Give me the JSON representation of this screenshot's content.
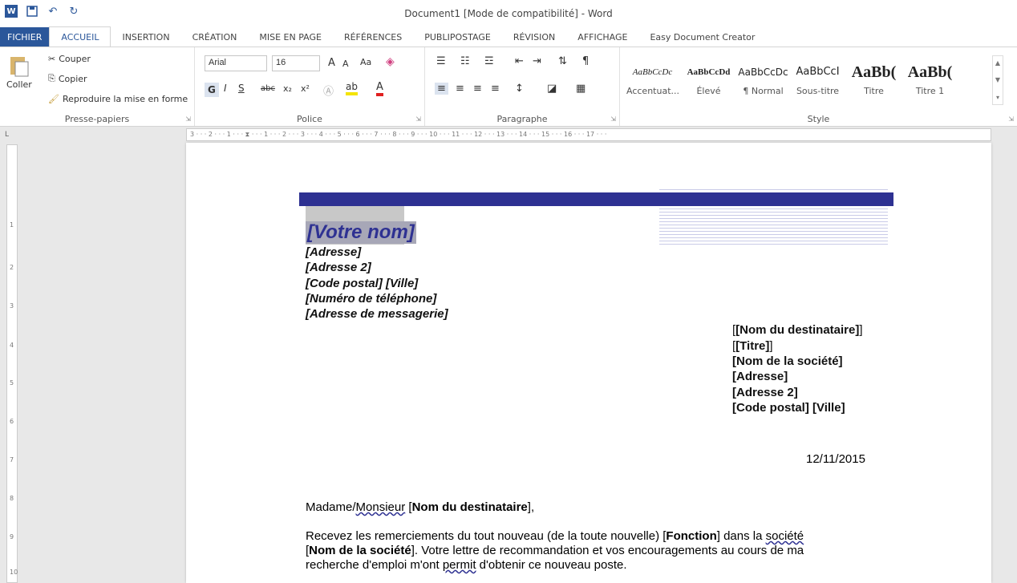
{
  "window": {
    "title": "Document1 [Mode de compatibilité] - Word",
    "word_logo": "W"
  },
  "qat": {
    "undo": "↶",
    "redo": "↻"
  },
  "tabs": [
    "FICHIER",
    "ACCUEIL",
    "INSERTION",
    "CRÉATION",
    "MISE EN PAGE",
    "RÉFÉRENCES",
    "PUBLIPOSTAGE",
    "RÉVISION",
    "AFFICHAGE",
    "Easy Document Creator"
  ],
  "clipboard": {
    "paste": "Coller",
    "cut": "Couper",
    "copy": "Copier",
    "format_painter": "Reproduire la mise en forme",
    "label": "Presse-papiers"
  },
  "font": {
    "name": "Arial",
    "size": "16",
    "grow": "A",
    "shrink": "A",
    "case": "Aa",
    "bold": "G",
    "italic": "I",
    "underline": "S",
    "strike": "abc",
    "subscript": "x₂",
    "superscript": "x²",
    "label": "Police"
  },
  "paragraph": {
    "label": "Paragraphe"
  },
  "styles": {
    "label": "Style",
    "items": [
      {
        "sample": "AaBbCcDc",
        "name": "Accentuat..."
      },
      {
        "sample": "AaBbCcDd",
        "name": "Élevé"
      },
      {
        "sample": "AaBbCcDc",
        "name": "¶ Normal"
      },
      {
        "sample": "AaBbCcI",
        "name": "Sous-titre"
      },
      {
        "sample": "AaBb(",
        "name": "Titre"
      },
      {
        "sample": "AaBb(",
        "name": "Titre 1"
      }
    ]
  },
  "ruler": {
    "h": "3 · · · 2 · · · 1 · · · ⧗ · · · 1 · · · 2 · · · 3 · · · 4 · · · 5 · · · 6 · · · 7 · · · 8 · · · 9 · · · 10 · · · 11 · · · 12 · · · 13 · · · 14 · · · 15 · · · 16 · · · 17 · · ·",
    "corner": "L",
    "v": [
      "1",
      "2",
      "3",
      "4",
      "5",
      "6",
      "7",
      "8",
      "9",
      "10"
    ]
  },
  "doc": {
    "name": "[Votre nom]",
    "sender": [
      "[Adresse]",
      "[Adresse 2]",
      "[Code postal] [Ville]",
      "[Numéro de téléphone]",
      "[Adresse de messagerie]"
    ],
    "recipient": [
      "[Nom du destinataire]",
      "[Titre]",
      "[Nom de la société]",
      "[Adresse]",
      "[Adresse 2]",
      "[Code postal] [Ville]"
    ],
    "date": "12/11/2015",
    "salutation_pre": "Madame/",
    "salutation_wavy": "Monsieur",
    "salutation_sp": " [",
    "salutation_bold": "Nom du destinataire",
    "salutation_post": "],",
    "p1_a": "Recevez les remerciements du tout nouveau (de la toute nouvelle) [",
    "p1_b": "Fonction",
    "p1_c": "] dans la ",
    "p1_d": "société",
    "p2_a": "[",
    "p2_b": "Nom de la société",
    "p2_c": "]. Votre lettre de recommandation et vos encouragements au cours de ma",
    "p3_a": "recherche d'emploi m'ont ",
    "p3_b": "permit",
    "p3_c": " d'obtenir ce nouveau poste."
  }
}
